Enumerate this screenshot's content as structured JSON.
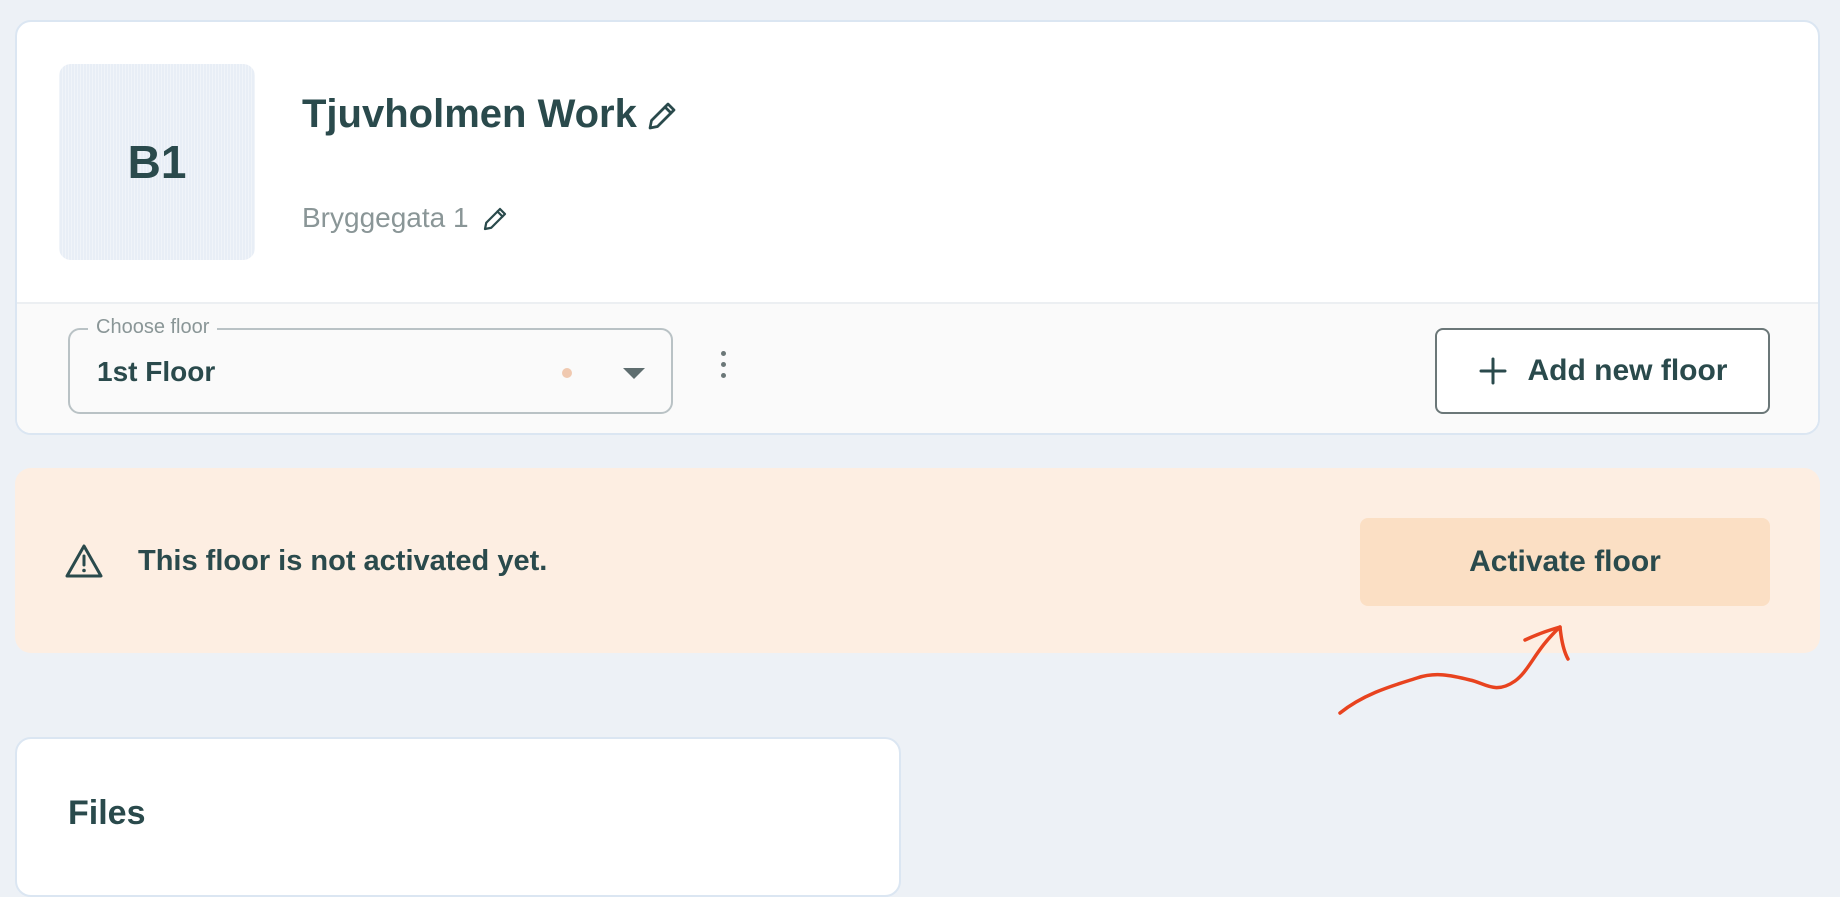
{
  "building": {
    "code": "B1",
    "name": "Tjuvholmen Work",
    "address": "Bryggegata 1"
  },
  "icons": {
    "edit": "pencil-icon",
    "more": "vertical-dots-icon",
    "add": "plus-icon",
    "warning": "warning-triangle-icon",
    "dropdown": "caret-down-icon"
  },
  "floor_selector": {
    "legend": "Choose floor",
    "selected": "1st Floor",
    "status_color": "#f0c9b0"
  },
  "add_floor": {
    "label": "Add new floor"
  },
  "banner": {
    "message": "This floor is not activated yet.",
    "button_label": "Activate floor",
    "background_color": "#fdeee2",
    "button_color": "#fbdfc4"
  },
  "annotation": {
    "color": "#e8431f",
    "shape": "hand-drawn arrow pointing to activate button"
  },
  "files": {
    "title": "Files"
  },
  "colors": {
    "page_bg": "#edf1f6",
    "text_primary": "#2a4a4c",
    "text_muted": "#8a9697"
  }
}
